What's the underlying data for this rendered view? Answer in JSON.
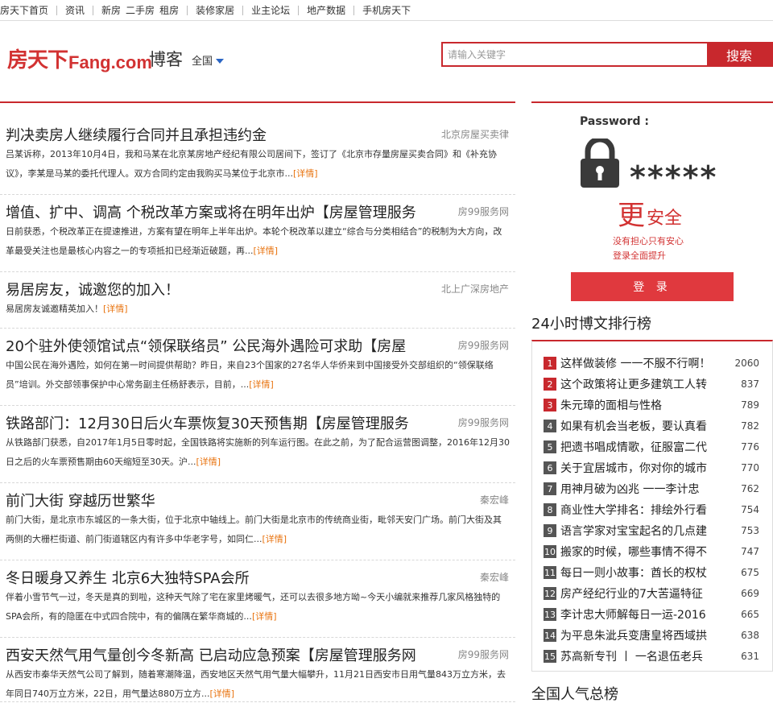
{
  "topnav": {
    "groups": [
      [
        "房天下首页"
      ],
      [
        "资讯"
      ],
      [
        "新房",
        "二手房",
        "租房"
      ],
      [
        "装修家居"
      ],
      [
        "业主论坛"
      ],
      [
        "地产数据"
      ],
      [
        "手机房天下"
      ]
    ]
  },
  "header": {
    "logo_cn": "房天下",
    "logo_en": "Fang.com",
    "blog_title": "博客",
    "region": "全国",
    "search_placeholder": "请输入关键字",
    "search_button": "搜索"
  },
  "articles": [
    {
      "title": "判决卖房人继续履行合同并且承担违约金",
      "author": "北京房屋买卖律",
      "summary": "吕某诉称，2013年10月4日，我和马某在北京某房地产经纪有限公司居间下，签订了《北京市存量房屋买卖合同》和《补充协议》，李某是马某的委托代理人。双方合同约定由我购买马某位于北京市...",
      "more": "[详情]"
    },
    {
      "title": "增值、扩中、调高 个税改革方案或将在明年出炉【房屋管理服务",
      "author": "房99服务网",
      "summary": "日前获悉，个税改革正在提速推进，方案有望在明年上半年出炉。本轮个税改革以建立“综合与分类相结合”的税制为大方向，改革最受关注也是最核心内容之一的专项抵扣已经渐近破题，再...",
      "more": "[详情]"
    },
    {
      "title": "易居房友，诚邀您的加入！",
      "author": "北上广深房地产",
      "summary": "易居房友诚邀精英加入！",
      "more": "[详情]"
    },
    {
      "title": "20个驻外使领馆试点“领保联络员” 公民海外遇险可求助【房屋",
      "author": "房99服务网",
      "summary": "中国公民在海外遇险，如何在第一时间提供帮助？昨日，来自23个国家的27名华人华侨来到中国接受外交部组织的“领保联络员”培训。外交部领事保护中心常务副主任杨舒表示，目前，...",
      "more": "[详情]"
    },
    {
      "title": "铁路部门：12月30日后火车票恢复30天预售期【房屋管理服务",
      "author": "房99服务网",
      "summary": "从铁路部门获悉，自2017年1月5日零时起，全国铁路将实施新的列车运行图。在此之前，为了配合运营图调整，2016年12月30日之后的火车票预售期由60天缩短至30天。沪...",
      "more": "[详情]"
    },
    {
      "title": "前门大街 穿越历世繁华",
      "author": "秦宏峰",
      "summary": "前门大街，是北京市东城区的一条大街，位于北京中轴线上。前门大街是北京市的传统商业街，毗邻天安门广场。前门大街及其两侧的大栅栏街道、前门街道辖区内有许多中华老字号，如同仁...",
      "more": "[详情]"
    },
    {
      "title": "冬日暖身又养生 北京6大独特SPA会所",
      "author": "秦宏峰",
      "summary": "伴着小雪节气一过，冬天是真的到啦，这种天气除了宅在家里烤暖气，还可以去很多地方呦~今天小编就来推荐几家风格独特的SPA会所，有的隐匿在中式四合院中，有的偏隅在繁华商城的...",
      "more": "[详情]"
    },
    {
      "title": "西安天然气用气量创今冬新高 已启动应急预案【房屋管理服务网",
      "author": "房99服务网",
      "summary": "从西安市秦华天然气公司了解到，随着寒潮降温，西安地区天然气用气量大幅攀升，11月21日西安市日用气量843万立方米，去年同日740万立方米，22日，用气量达880万立方...",
      "more": "[详情]"
    }
  ],
  "promo": {
    "password_label": "Password :",
    "stars": "*****",
    "secure_big": "更",
    "secure_small": "安全",
    "slogan1": "没有担心只有安心",
    "slogan2": "登录全面提升",
    "login_button": "登 录"
  },
  "ranking": {
    "heading": "24小时博文排行榜",
    "items": [
      {
        "num": "1",
        "title": "这样做装修 一一不服不行啊！",
        "count": "2060"
      },
      {
        "num": "2",
        "title": "这个政策将让更多建筑工人转",
        "count": "837"
      },
      {
        "num": "3",
        "title": "朱元璋的面相与性格",
        "count": "789"
      },
      {
        "num": "4",
        "title": "如果有机会当老板，要认真看",
        "count": "782"
      },
      {
        "num": "5",
        "title": "把遗书唱成情歌，征服富二代",
        "count": "776"
      },
      {
        "num": "6",
        "title": "关于宜居城市，你对你的城市",
        "count": "770"
      },
      {
        "num": "7",
        "title": "用神月破为凶兆 一一李计忠",
        "count": "762"
      },
      {
        "num": "8",
        "title": "商业性大学排名：排绘外行看",
        "count": "754"
      },
      {
        "num": "9",
        "title": "语言学家对宝宝起名的几点建",
        "count": "753"
      },
      {
        "num": "10",
        "title": "搬家的时候，哪些事情不得不",
        "count": "747"
      },
      {
        "num": "11",
        "title": "每日一则小故事：酋长的权杖",
        "count": "675"
      },
      {
        "num": "12",
        "title": "房产经纪行业的7大苦逼特征",
        "count": "669"
      },
      {
        "num": "13",
        "title": "李计忠大师解每日一运-2016",
        "count": "665"
      },
      {
        "num": "14",
        "title": "为平息朱泚兵变唐皇将西域拱",
        "count": "638"
      },
      {
        "num": "15",
        "title": "苏高新专刊 丨 一名退伍老兵",
        "count": "631"
      }
    ]
  },
  "nation": {
    "heading": "全国人气总榜"
  }
}
